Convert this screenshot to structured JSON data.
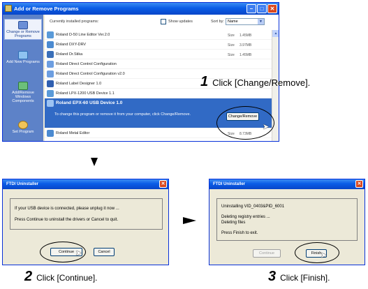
{
  "arp_window": {
    "title": "Add or Remove Programs",
    "sidebar": [
      {
        "label": "Change or Remove Programs",
        "icon": "programs-icon",
        "selected": true
      },
      {
        "label": "Add New Programs",
        "icon": "add-programs-icon"
      },
      {
        "label": "Add/Remove Windows Components",
        "icon": "windows-components-icon"
      },
      {
        "label": "Set Program",
        "icon": "set-program-icon"
      }
    ],
    "header": {
      "installed_label": "Currently installed programs:",
      "show_updates_label": "Show updates",
      "sort_by_label": "Sort by:",
      "sort_by_value": "Name"
    },
    "rows": [
      {
        "name": "Roland D-50 Line Editor Ver.2.0",
        "size_label": "Size",
        "size": "1.45MB"
      },
      {
        "name": "Roland DXY-DRV",
        "size_label": "Size",
        "size": "3.97MB"
      },
      {
        "name": "Roland Dr.Stika",
        "size_label": "Size",
        "size": "1.45MB"
      },
      {
        "name": "Roland Direct Control Configuration",
        "size_label": "",
        "size": ""
      },
      {
        "name": "Roland Direct Control Configuration v2.0",
        "size_label": "",
        "size": ""
      },
      {
        "name": "Roland Label Designer 1.0",
        "size_label": "",
        "size": ""
      },
      {
        "name": "Roland LPX-1200 USB Device 1.1",
        "size_label": "",
        "size": ""
      },
      {
        "name": "Roland Metal Editor",
        "size_label": "Size",
        "size": "8.73MB"
      }
    ],
    "selected_row": {
      "name": "Roland EPX-60 USB Device 1.0",
      "description": "To change this program or remove it from your computer, click Change/Remove.",
      "button": "Change/Remove"
    }
  },
  "steps": {
    "step1_num": "1",
    "step1_text": "Click [Change/Remove].",
    "step2_num": "2",
    "step2_text": "Click [Continue].",
    "step3_num": "3",
    "step3_text": "Click [Finish]."
  },
  "dialog1": {
    "title": "FTDI Uninstaller",
    "line1": "If your USB device is connected, please unplug it now ...",
    "line2": "Press Continue to uninstall the drivers or Cancel to quit.",
    "continue_label": "Continue",
    "cancel_label": "Cancel"
  },
  "dialog2": {
    "title": "FTDI Uninstaller",
    "line1": "Uninstalling VID_0403&PID_6001",
    "line2": "Deleting registry entries ...",
    "line3": "Deleting files",
    "line4": "Press Finish to exit.",
    "continue_label": "Continue",
    "finish_label": "Finish"
  },
  "colors": {
    "titlebar_blue": "#0a5ce6",
    "selection_blue": "#316ac5",
    "sidebar_blue": "#5d82c8",
    "dialog_face": "#ece9d8"
  }
}
